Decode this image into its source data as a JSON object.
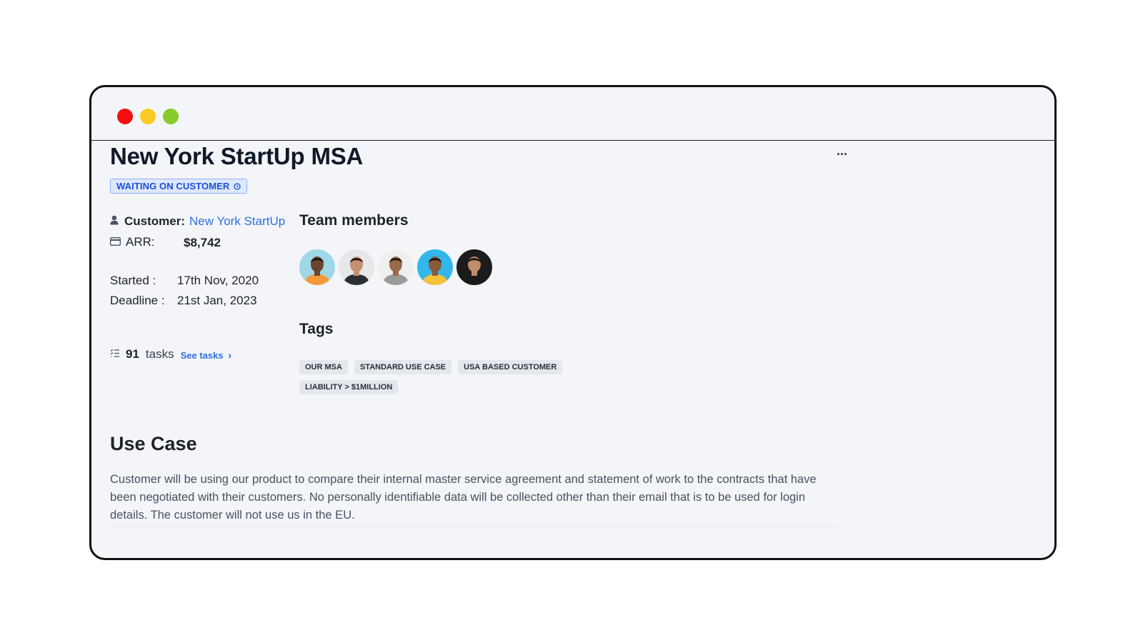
{
  "window": {
    "controls": [
      "close",
      "minimize",
      "maximize"
    ],
    "colors": {
      "close": "#f20f0f",
      "minimize": "#fbcb25",
      "maximize": "#86cc2a"
    }
  },
  "contract": {
    "title": "New York StartUp MSA",
    "more_label": "···",
    "status": "WAITING ON CUSTOMER",
    "status_icon": "clock-icon"
  },
  "details": {
    "customer_label": "Customer:",
    "customer_value": "New York StartUp",
    "arr_label": "ARR:",
    "arr_value": "$8,742",
    "started_label": "Started :",
    "started_value": "17th Nov, 2020",
    "deadline_label": "Deadline :",
    "deadline_value": "21st Jan, 2023",
    "tasks_count": "91",
    "tasks_label": "tasks",
    "see_tasks": "See tasks",
    "see_tasks_chevron": "›"
  },
  "team": {
    "heading": "Team members",
    "members": [
      {
        "bg": "#9fd8e6",
        "skin": "#6b4430",
        "shirt": "#f49a3a"
      },
      {
        "bg": "#e7e7e9",
        "skin": "#c69072",
        "shirt": "#2a2d33"
      },
      {
        "bg": "#eef0ee",
        "skin": "#9a6a4c",
        "shirt": "#9a9a98"
      },
      {
        "bg": "#33b7ea",
        "skin": "#8a5a3c",
        "shirt": "#f6c23a"
      },
      {
        "bg": "#1c1c1c",
        "skin": "#c28c6a",
        "shirt": "#1a1a1a"
      }
    ]
  },
  "tags": {
    "heading": "Tags",
    "items": [
      "OUR MSA",
      "STANDARD USE CASE",
      "USA BASED CUSTOMER",
      "LIABILITY > $1MILLION"
    ]
  },
  "use_case": {
    "heading": "Use Case",
    "body": "Customer will be using our product to compare their internal master service agreement and statement of work to the contracts that have been negotiated with their customers. No personally identifiable data will be collected other than their email that is to be used for login details. The customer will not use us in the EU."
  }
}
